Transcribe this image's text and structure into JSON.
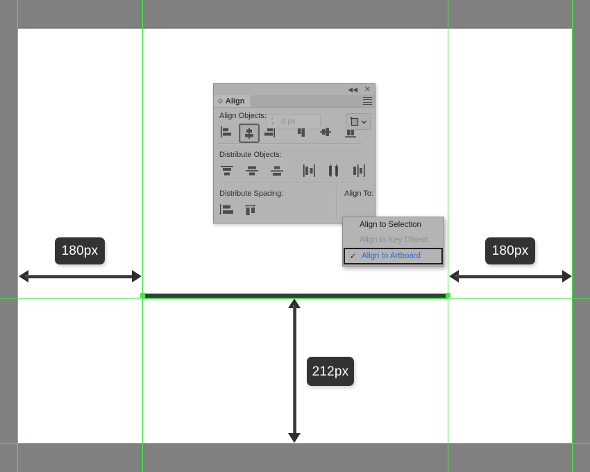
{
  "app": {
    "background_color": "#808080",
    "canvas_color": "#ffffff",
    "guide_color": "#3bf03b"
  },
  "panel": {
    "title": "Align",
    "tab_grip_icon": "grip-diamond-icon",
    "collapse_icon": "collapse-left-icon",
    "collapse_glyph": "◀◀",
    "close_icon": "close-icon",
    "close_glyph": "✕",
    "menu_icon": "panel-menu-icon",
    "sections": {
      "align_objects": {
        "label": "Align Objects:",
        "buttons": [
          {
            "name": "horizontal-align-left",
            "selected": false
          },
          {
            "name": "horizontal-align-center",
            "selected": true
          },
          {
            "name": "horizontal-align-right",
            "selected": false
          },
          {
            "name": "vertical-align-top",
            "selected": false
          },
          {
            "name": "vertical-align-center",
            "selected": false
          },
          {
            "name": "vertical-align-bottom",
            "selected": false
          }
        ]
      },
      "distribute_objects": {
        "label": "Distribute Objects:",
        "buttons": [
          {
            "name": "vertical-distribute-top",
            "selected": false
          },
          {
            "name": "vertical-distribute-center",
            "selected": false
          },
          {
            "name": "vertical-distribute-bottom",
            "selected": false
          },
          {
            "name": "horizontal-distribute-left",
            "selected": false
          },
          {
            "name": "horizontal-distribute-center",
            "selected": false
          },
          {
            "name": "horizontal-distribute-right",
            "selected": false
          }
        ]
      },
      "distribute_spacing": {
        "label": "Distribute Spacing:",
        "buttons": [
          {
            "name": "vertical-distribute-space",
            "selected": false
          },
          {
            "name": "horizontal-distribute-space",
            "selected": false
          }
        ],
        "spacing_value": "0 px",
        "spacing_placeholder": "0 px",
        "spacing_enabled": false
      },
      "align_to": {
        "label": "Align To:",
        "button_icon": "align-to-artboard-icon",
        "chevron_icon": "chevron-down-icon"
      }
    }
  },
  "dropdown": {
    "items": [
      {
        "label": "Align to Selection",
        "state": "normal",
        "checked": false
      },
      {
        "label": "Align to Key Object",
        "state": "disabled",
        "checked": false
      },
      {
        "label": "Align to Artboard",
        "state": "selected",
        "checked": true
      }
    ],
    "selected_color": "#1f6fe0",
    "check_glyph": "✓"
  },
  "measurements": [
    {
      "name": "left-gap",
      "label": "180px",
      "orientation": "horizontal"
    },
    {
      "name": "right-gap",
      "label": "180px",
      "orientation": "horizontal"
    },
    {
      "name": "bottom-gap",
      "label": "212px",
      "orientation": "vertical"
    }
  ],
  "selection": {
    "object": "horizontal-line-path",
    "handle_color": "#3bf03b"
  }
}
